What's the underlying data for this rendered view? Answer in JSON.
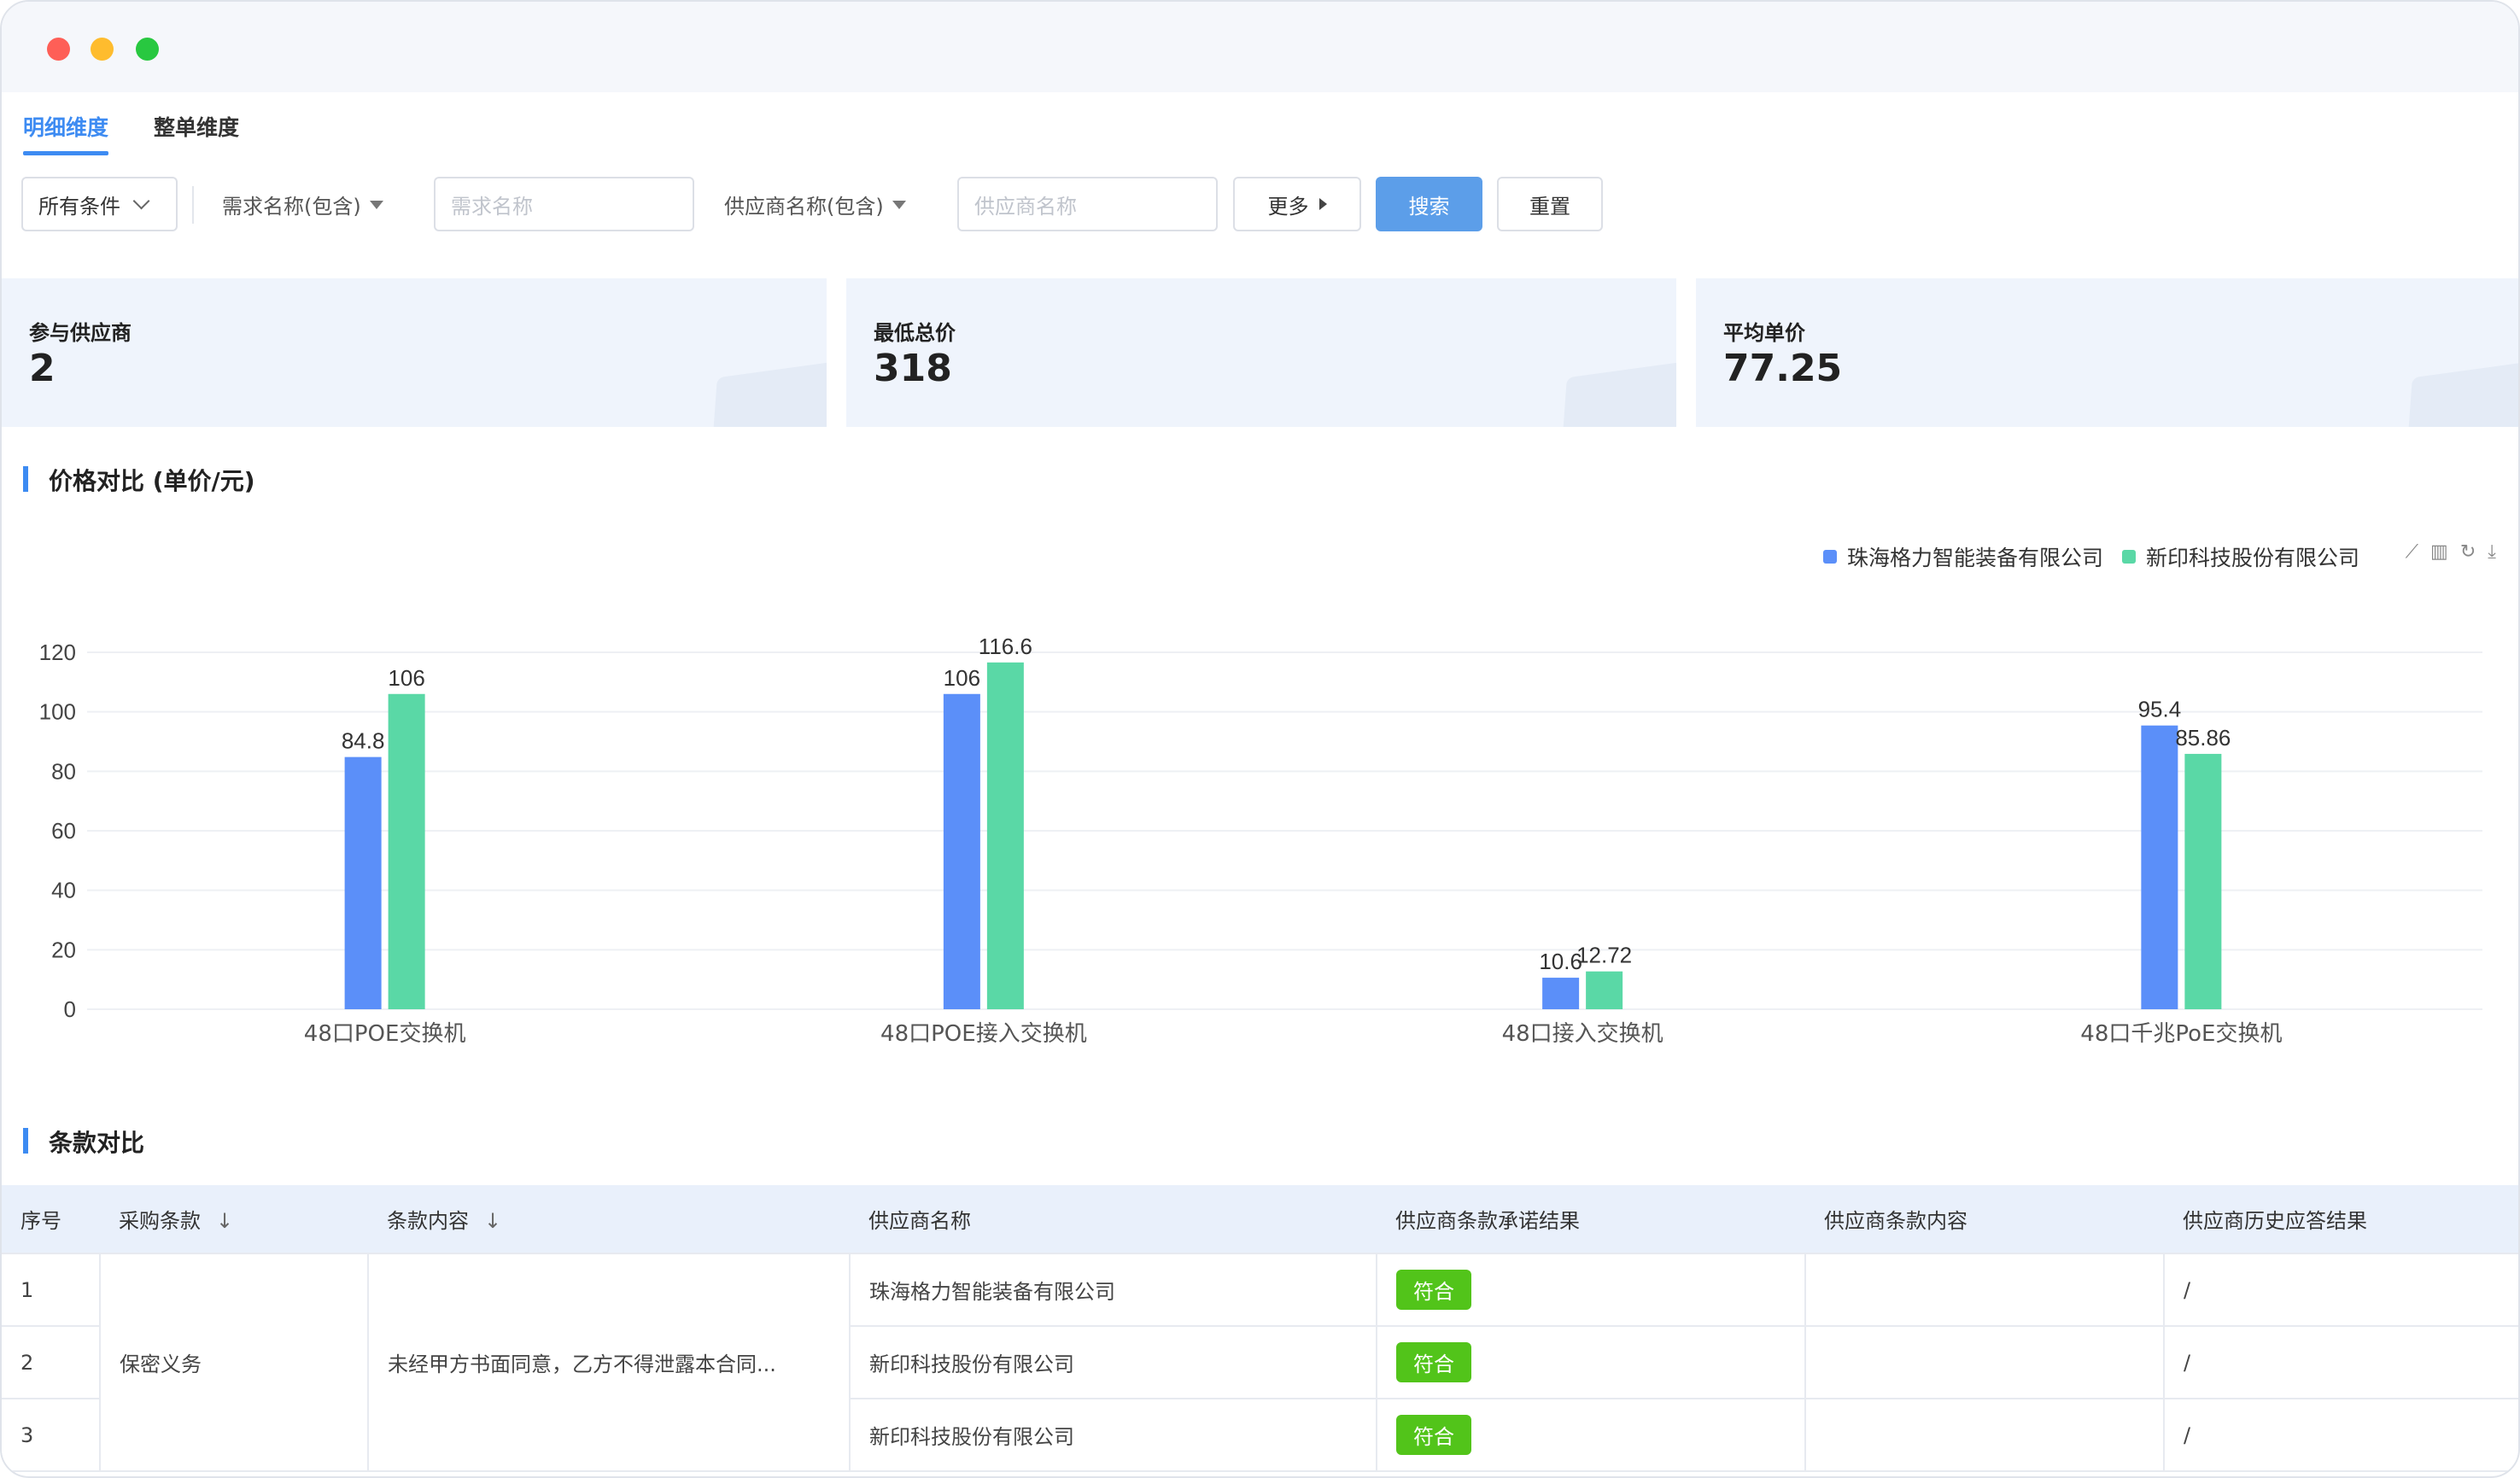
{
  "tabs": [
    {
      "label": "明细维度",
      "active": true
    },
    {
      "label": "整单维度",
      "active": false
    }
  ],
  "filters": {
    "all_conditions": "所有条件",
    "demand_name_label": "需求名称(包含)",
    "demand_name_placeholder": "需求名称",
    "supplier_name_label": "供应商名称(包含)",
    "supplier_name_placeholder": "供应商名称",
    "more_label": "更多",
    "search_label": "搜索",
    "reset_label": "重置"
  },
  "stats": [
    {
      "label": "参与供应商",
      "value": "2"
    },
    {
      "label": "最低总价",
      "value": "318"
    },
    {
      "label": "平均单价",
      "value": "77.25"
    }
  ],
  "price_section_title": "价格对比 (单价/元)",
  "terms_section_title": "条款对比",
  "colors": {
    "accent": "#3d8bf2",
    "series1": "#5b8ff9",
    "series2": "#5ad8a6",
    "badge": "#52c41a"
  },
  "chart_data": {
    "type": "bar",
    "categories": [
      "48口POE交换机",
      "48口POE接入交换机",
      "48口接入交换机",
      "48口千兆PoE交换机"
    ],
    "series": [
      {
        "name": "珠海格力智能装备有限公司",
        "values": [
          84.8,
          106,
          10.6,
          95.4
        ],
        "labels": [
          "84.8",
          "106",
          "10.6",
          "95.4"
        ]
      },
      {
        "name": "新印科技股份有限公司",
        "values": [
          106,
          116.6,
          12.72,
          85.86
        ],
        "labels": [
          "106",
          "116.6",
          "12.72",
          "85.86"
        ]
      }
    ],
    "ylim": [
      0,
      120
    ],
    "yticks": [
      "0",
      "20",
      "40",
      "60",
      "80",
      "100",
      "120"
    ],
    "legend": "top-right",
    "grid": true
  },
  "table": {
    "headers": [
      "序号",
      "采购条款",
      "条款内容",
      "供应商名称",
      "供应商条款承诺结果",
      "供应商条款内容",
      "供应商历史应答结果"
    ],
    "sort_arrow": "↓",
    "clause": "保密义务",
    "clause_content": "未经甲方书面同意，乙方不得泄露本合同...",
    "rows": [
      {
        "index": "1",
        "supplier": "珠海格力智能装备有限公司",
        "result": "符合",
        "content": "",
        "history": "/"
      },
      {
        "index": "2",
        "supplier": "新印科技股份有限公司",
        "result": "符合",
        "content": "",
        "history": "/"
      },
      {
        "index": "3",
        "supplier": "新印科技股份有限公司",
        "result": "符合",
        "content": "",
        "history": "/"
      }
    ]
  }
}
